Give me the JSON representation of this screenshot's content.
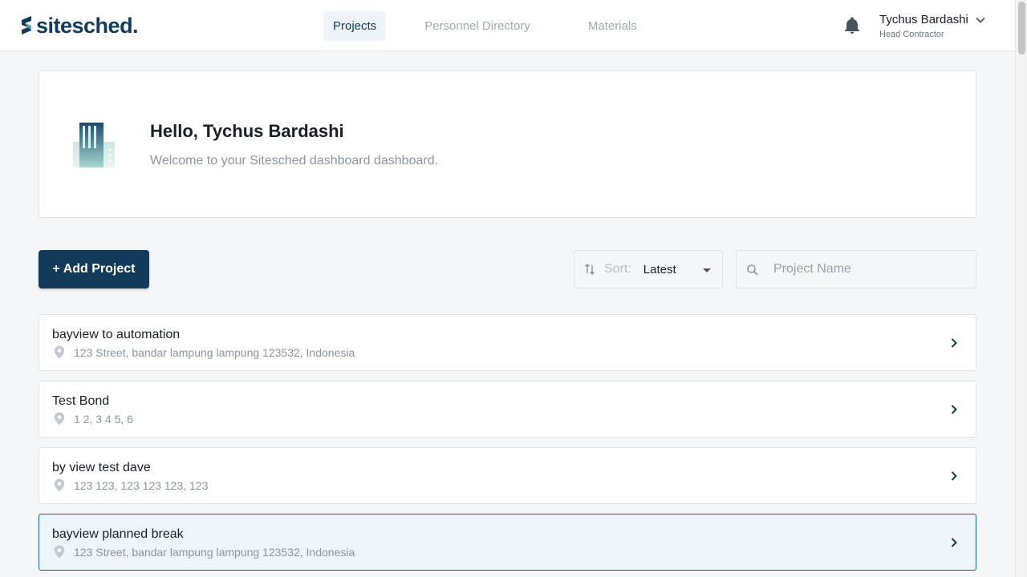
{
  "brand": {
    "name": "sitesched.",
    "accent": "#143a5a"
  },
  "nav": [
    {
      "label": "Projects",
      "active": true
    },
    {
      "label": "Personnel Directory",
      "active": false
    },
    {
      "label": "Materials",
      "active": false
    }
  ],
  "user": {
    "name": "Tychus Bardashi",
    "role": "Head Contractor"
  },
  "welcome": {
    "title": "Hello, Tychus Bardashi",
    "subtitle": "Welcome to your Sitesched dashboard dashboard."
  },
  "toolbar": {
    "add_label": "+ Add Project",
    "sort_label": "Sort:",
    "sort_value": "Latest",
    "search_placeholder": "Project Name"
  },
  "projects": [
    {
      "name": "bayview to automation",
      "address": "123 Street, bandar lampung lampung 123532, Indonesia"
    },
    {
      "name": "Test Bond",
      "address": "1 2, 3 4 5, 6"
    },
    {
      "name": "by view test dave",
      "address": "123 123, 123 123 123, 123"
    },
    {
      "name": "bayview planned break",
      "address": "123 Street, bandar lampung lampung 123532, Indonesia"
    }
  ],
  "icons": {
    "bell": "bell-icon",
    "chevron_down": "chevron-down-icon",
    "sort": "sort-icon",
    "search": "search-icon",
    "pin": "map-pin-icon",
    "chevron_right": "chevron-right-icon"
  }
}
